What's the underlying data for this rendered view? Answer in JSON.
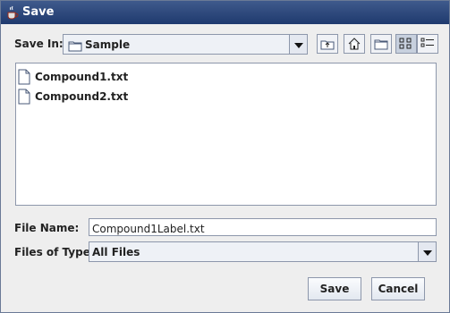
{
  "window": {
    "title": "Save"
  },
  "save_in": {
    "label": "Save In:",
    "value": "Sample"
  },
  "toolbar": {
    "up_icon": "up-one-level-icon",
    "home_icon": "home-icon",
    "new_folder_icon": "new-folder-icon",
    "list_icon": "list-view-icon",
    "details_icon": "details-view-icon"
  },
  "files": [
    {
      "name": "Compound1.txt"
    },
    {
      "name": "Compound2.txt"
    }
  ],
  "file_name": {
    "label": "File Name:",
    "value": "Compound1Label.txt"
  },
  "files_of_type": {
    "label": "Files of Type:",
    "value": "All Files"
  },
  "buttons": {
    "save": "Save",
    "cancel": "Cancel"
  }
}
